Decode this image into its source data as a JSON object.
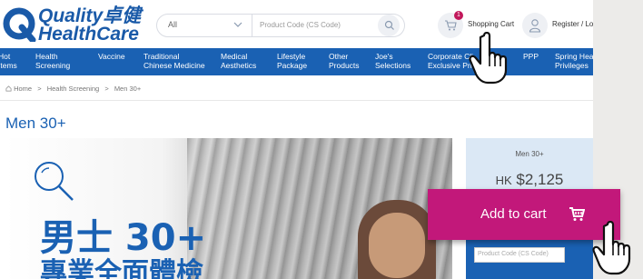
{
  "header": {
    "logo_line1": "Quality卓健",
    "logo_line2": "HealthCare",
    "search_category": "All",
    "search_placeholder": "Product Code (CS Code)",
    "cart_count": "1",
    "cart_label": "Shopping Cart",
    "account_label": "Register / Log"
  },
  "nav": {
    "items": [
      {
        "line1": "Hot",
        "line2": "Items"
      },
      {
        "line1": "Health",
        "line2": "Screening"
      },
      {
        "line1": "Vaccine",
        "line2": ""
      },
      {
        "line1": "Traditional",
        "line2": "Chinese Medicine"
      },
      {
        "line1": "Medical",
        "line2": "Aesthetics"
      },
      {
        "line1": "Lifestyle",
        "line2": "Package"
      },
      {
        "line1": "Other",
        "line2": "Products"
      },
      {
        "line1": "Joe's",
        "line2": "Selections"
      },
      {
        "line1": "Corporate Cli",
        "line2": "Exclusive Priv"
      },
      {
        "line1": "PPP",
        "line2": ""
      },
      {
        "line1": "Spring Hea",
        "line2": "Privileges"
      }
    ]
  },
  "breadcrumb": {
    "home": "Home",
    "sep": ">",
    "category": "Health Screening",
    "current": "Men 30+"
  },
  "page_title": "Men 30+",
  "banner": {
    "headline": "男士 30+",
    "subline": "專業全面體檢"
  },
  "panel": {
    "product_name": "Men 30+",
    "currency": "HK",
    "price": "$2,125",
    "code_placeholder": "Product Code (CS Code)"
  },
  "add_to_cart": {
    "label": "Add to cart"
  },
  "colors": {
    "brand_blue": "#1a61b3",
    "accent_magenta": "#c2187a",
    "panel_bg": "#dbe8f5"
  }
}
